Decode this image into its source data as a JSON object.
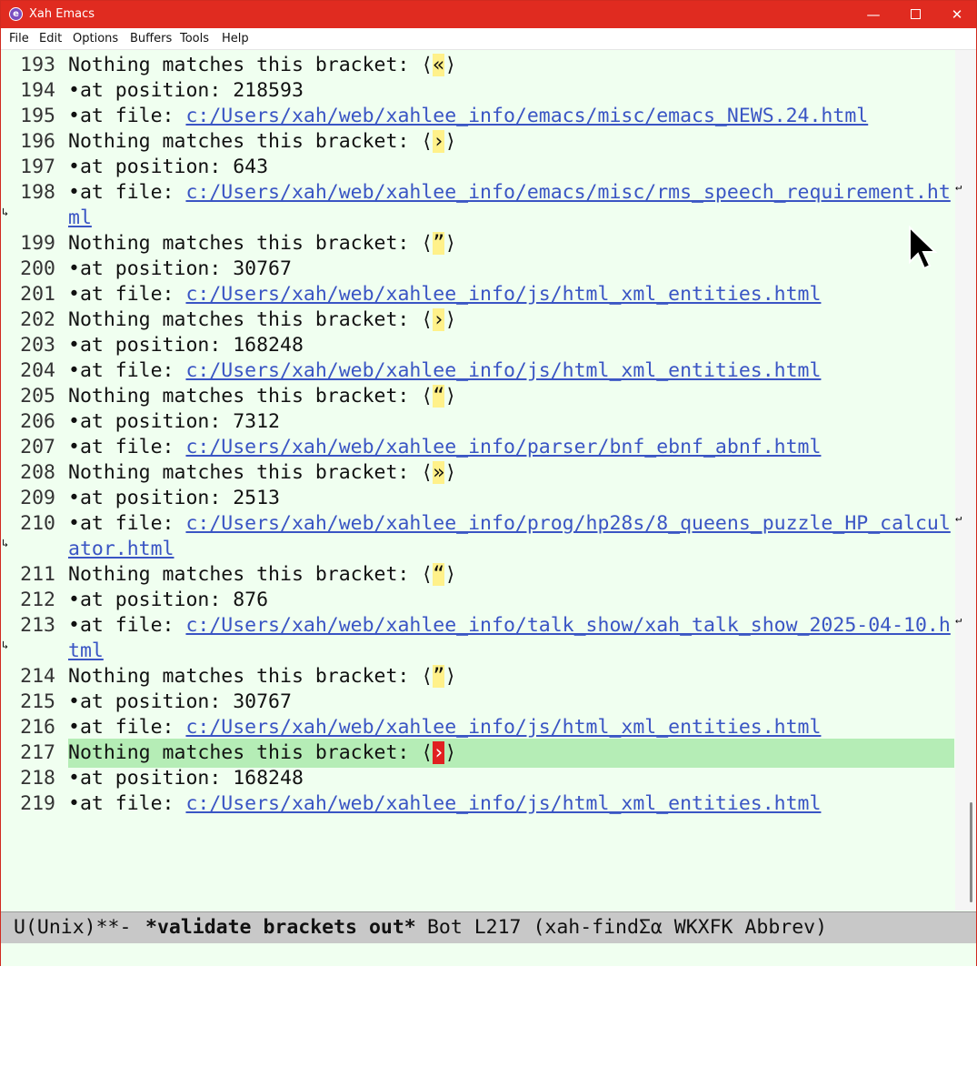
{
  "window": {
    "title": "Xah Emacs"
  },
  "menu": [
    "File",
    "Edit",
    "Options",
    "Buffers",
    "Tools",
    "Help"
  ],
  "lines": [
    {
      "n": "193",
      "kind": "nm",
      "text": "Nothing matches this bracket: ",
      "open": "⟨",
      "ch": "«",
      "close": "⟩"
    },
    {
      "n": "194",
      "kind": "pos",
      "text": "•at position: 218593"
    },
    {
      "n": "195",
      "kind": "file",
      "pre": "•at file: ",
      "link": "c:/Users/xah/web/xahlee_info/emacs/misc/emacs_NEWS.24.html"
    },
    {
      "n": "196",
      "kind": "nm",
      "text": "Nothing matches this bracket: ",
      "open": "⟨",
      "ch": "›",
      "close": "⟩"
    },
    {
      "n": "197",
      "kind": "pos",
      "text": "•at position: 643"
    },
    {
      "n": "198",
      "kind": "file",
      "pre": "•at file: ",
      "link": "c:/Users/xah/web/xahlee_info/emacs/misc/rms_speech_requirement.ht",
      "cont": "ml"
    },
    {
      "n": "199",
      "kind": "nm",
      "text": "Nothing matches this bracket: ",
      "open": "⟨",
      "ch": "”",
      "close": "⟩"
    },
    {
      "n": "200",
      "kind": "pos",
      "text": "•at position: 30767"
    },
    {
      "n": "201",
      "kind": "file",
      "pre": "•at file: ",
      "link": "c:/Users/xah/web/xahlee_info/js/html_xml_entities.html"
    },
    {
      "n": "202",
      "kind": "nm",
      "text": "Nothing matches this bracket: ",
      "open": "⟨",
      "ch": "›",
      "close": "⟩"
    },
    {
      "n": "203",
      "kind": "pos",
      "text": "•at position: 168248"
    },
    {
      "n": "204",
      "kind": "file",
      "pre": "•at file: ",
      "link": "c:/Users/xah/web/xahlee_info/js/html_xml_entities.html"
    },
    {
      "n": "205",
      "kind": "nm",
      "text": "Nothing matches this bracket: ",
      "open": "⟨",
      "ch": "“",
      "close": "⟩"
    },
    {
      "n": "206",
      "kind": "pos",
      "text": "•at position: 7312"
    },
    {
      "n": "207",
      "kind": "file",
      "pre": "•at file: ",
      "link": "c:/Users/xah/web/xahlee_info/parser/bnf_ebnf_abnf.html"
    },
    {
      "n": "208",
      "kind": "nm",
      "text": "Nothing matches this bracket: ",
      "open": "⟨",
      "ch": "»",
      "close": "⟩"
    },
    {
      "n": "209",
      "kind": "pos",
      "text": "•at position: 2513"
    },
    {
      "n": "210",
      "kind": "file",
      "pre": "•at file: ",
      "link": "c:/Users/xah/web/xahlee_info/prog/hp28s/8_queens_puzzle_HP_calcul",
      "cont": "ator.html"
    },
    {
      "n": "211",
      "kind": "nm",
      "text": "Nothing matches this bracket: ",
      "open": "⟨",
      "ch": "“",
      "close": "⟩"
    },
    {
      "n": "212",
      "kind": "pos",
      "text": "•at position: 876"
    },
    {
      "n": "213",
      "kind": "file",
      "pre": "•at file: ",
      "link": "c:/Users/xah/web/xahlee_info/talk_show/xah_talk_show_2025-04-10.h",
      "cont": "tml"
    },
    {
      "n": "214",
      "kind": "nm",
      "text": "Nothing matches this bracket: ",
      "open": "⟨",
      "ch": "”",
      "close": "⟩"
    },
    {
      "n": "215",
      "kind": "pos",
      "text": "•at position: 30767"
    },
    {
      "n": "216",
      "kind": "file",
      "pre": "•at file: ",
      "link": "c:/Users/xah/web/xahlee_info/js/html_xml_entities.html"
    },
    {
      "n": "217",
      "kind": "nm",
      "text": "Nothing matches this bracket: ",
      "open": "⟨",
      "ch": "›",
      "close": "⟩",
      "current": true
    },
    {
      "n": "218",
      "kind": "pos",
      "text": "•at position: 168248"
    },
    {
      "n": "219",
      "kind": "file",
      "pre": "•at file: ",
      "link": "c:/Users/xah/web/xahlee_info/js/html_xml_entities.html"
    }
  ],
  "modeline": {
    "prefix": "U(Unix)**-  ",
    "buffer": "*validate brackets out*",
    "rest": " Bot L217 (xah-findΣα WKXFK Abbrev)"
  },
  "colors": {
    "titlebar": "#e02b20",
    "background": "#f0fff0",
    "current_line": "#b5edb6",
    "link": "#3a55c4",
    "bracket_highlight": "#fff18a",
    "cursor": "#e02020"
  }
}
